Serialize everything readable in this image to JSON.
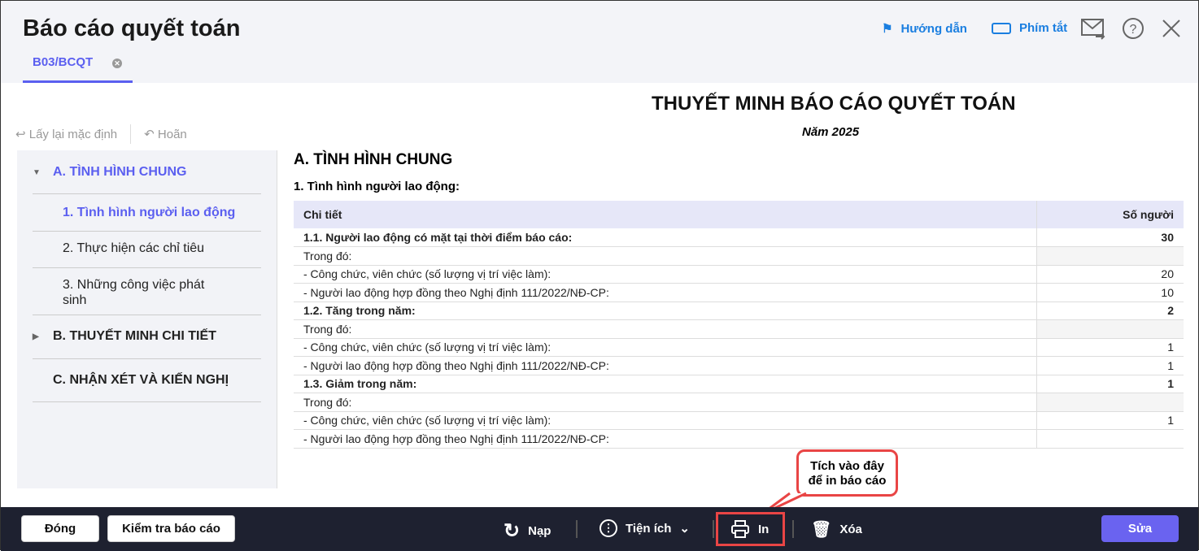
{
  "header": {
    "title": "Báo cáo quyết toán",
    "tab": "B03/BCQT",
    "guide": "Hướng dẫn",
    "shortcuts": "Phím tắt"
  },
  "toolbar": {
    "reset": "Lấy lại mặc định",
    "undo": "Hoãn"
  },
  "sidebar": {
    "items": [
      "A. TÌNH HÌNH CHUNG",
      "1. Tình hình người lao động",
      "2. Thực hiện các chỉ tiêu",
      "3. Những công việc phát sinh",
      "B. THUYẾT MINH CHI TIẾT",
      "C. NHẬN XÉT VÀ KIẾN NGHỊ"
    ]
  },
  "report": {
    "title": "THUYẾT MINH BÁO CÁO QUYẾT TOÁN",
    "year": "Năm 2025",
    "section": "A. TÌNH HÌNH CHUNG",
    "subsection": "1. Tình hình người lao động:",
    "columns": [
      "Chi tiết",
      "Số người"
    ],
    "rows": [
      [
        "1.1. Người lao động có mặt tại thời điểm báo cáo:",
        "30"
      ],
      [
        "Trong đó:",
        ""
      ],
      [
        "- Công chức, viên chức (số lượng vị trí việc làm):",
        "20"
      ],
      [
        "- Người lao động hợp đồng theo Nghị định 111/2022/NĐ-CP:",
        "10"
      ],
      [
        "1.2. Tăng trong năm:",
        "2"
      ],
      [
        "Trong đó:",
        ""
      ],
      [
        "- Công chức, viên chức (số lượng vị trí việc làm):",
        "1"
      ],
      [
        "- Người lao động hợp đồng theo Nghị định 111/2022/NĐ-CP:",
        "1"
      ],
      [
        "1.3. Giảm trong năm:",
        "1"
      ],
      [
        "Trong đó:",
        ""
      ],
      [
        "- Công chức, viên chức (số lượng vị trí việc làm):",
        "1"
      ],
      [
        "- Người lao động hợp đồng theo Nghị định 111/2022/NĐ-CP:",
        ""
      ]
    ]
  },
  "footer": {
    "close": "Đóng",
    "check": "Kiểm tra báo cáo",
    "reload": "Nạp",
    "utilities": "Tiện ích",
    "print": "In",
    "delete": "Xóa",
    "edit": "Sửa"
  },
  "callout": {
    "line1": "Tích vào đây",
    "line2": "để in báo cáo"
  }
}
